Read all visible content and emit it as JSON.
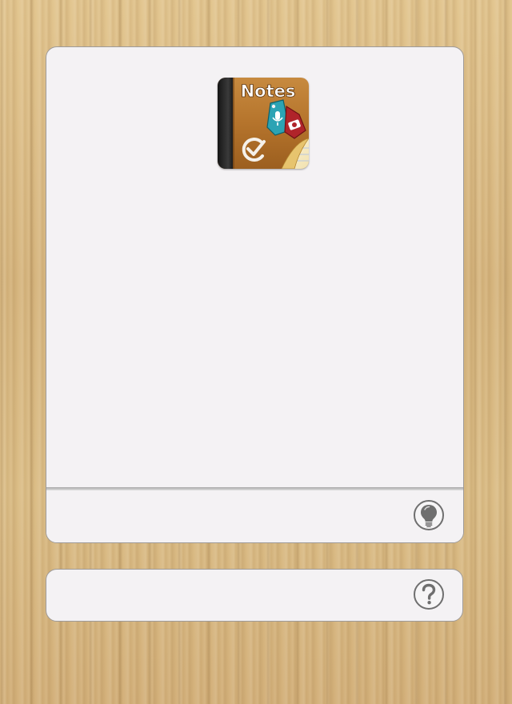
{
  "app": {
    "icon_name": "notes-app-icon",
    "icon_text": "Notes"
  },
  "footer": {
    "tip_icon": "lightbulb-icon"
  },
  "help": {
    "icon": "question-mark-icon"
  },
  "colors": {
    "panel_background": "#f4f2f4",
    "wood_background": "#d9b77f",
    "button_stroke": "#6f6f6f"
  }
}
